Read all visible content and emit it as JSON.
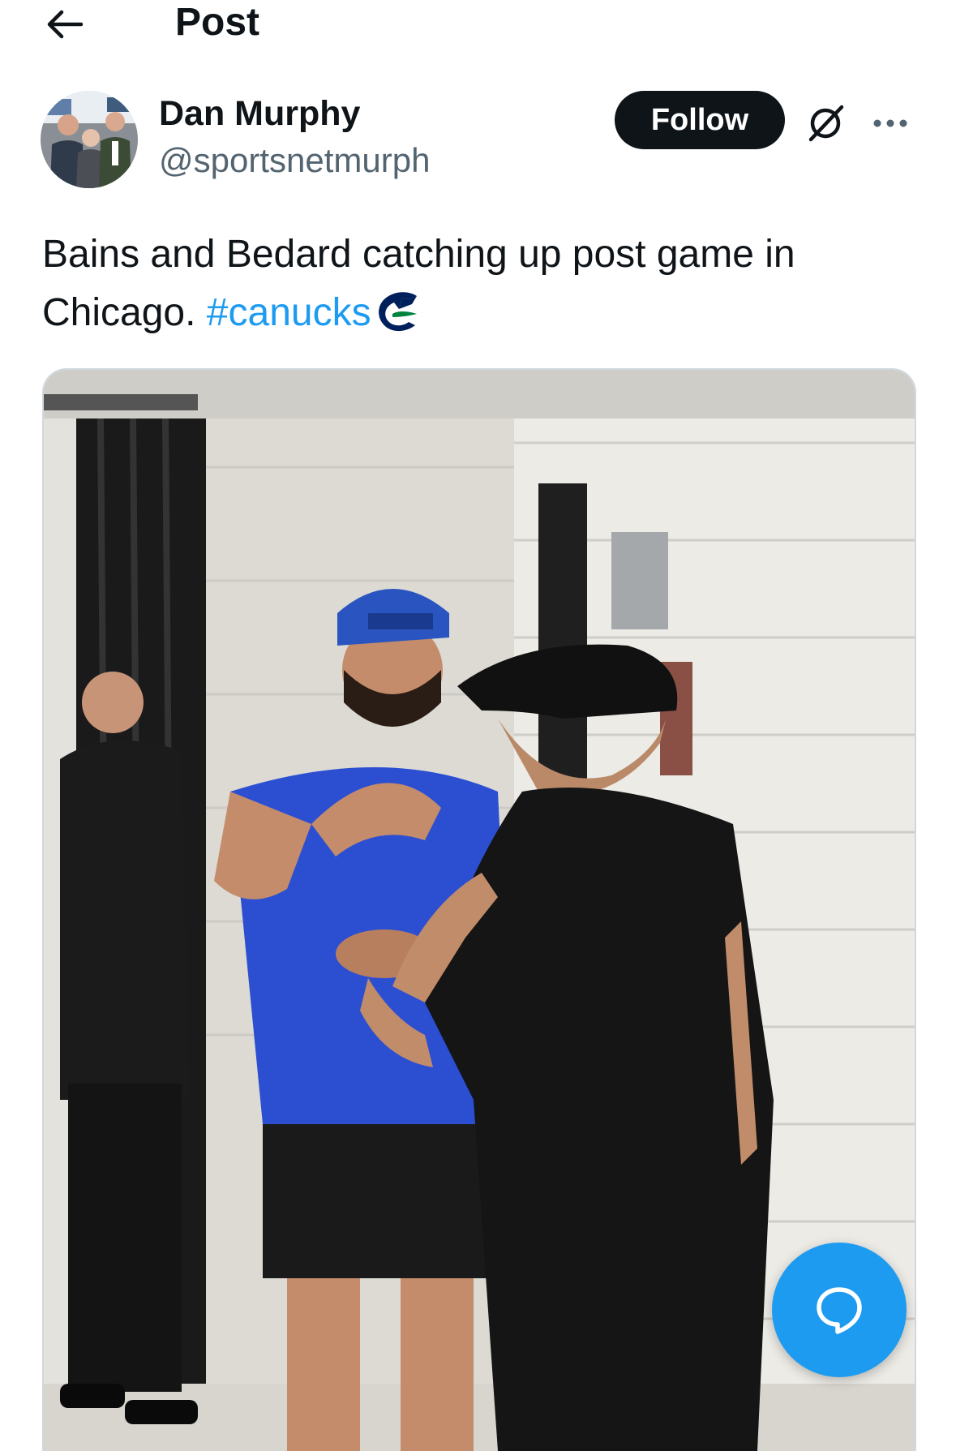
{
  "header": {
    "back_icon": "arrow-left-icon",
    "title": "Post"
  },
  "author": {
    "name": "Dan Murphy",
    "handle": "@sportsnetmurph",
    "follow_label": "Follow",
    "grok_icon": "grok-icon",
    "more_icon": "more-horizontal-icon"
  },
  "tweet": {
    "text": "Bains and Bedard catching up post game in Chicago.",
    "hashtag": "#canucks",
    "emoji_icon": "canucks-orca-icon"
  },
  "media": {
    "type": "photo"
  },
  "fab": {
    "icon": "compose-reply-icon"
  },
  "colors": {
    "accent": "#1d9bf0",
    "text": "#0f1419",
    "secondary": "#536471",
    "border": "#cfd9de"
  }
}
